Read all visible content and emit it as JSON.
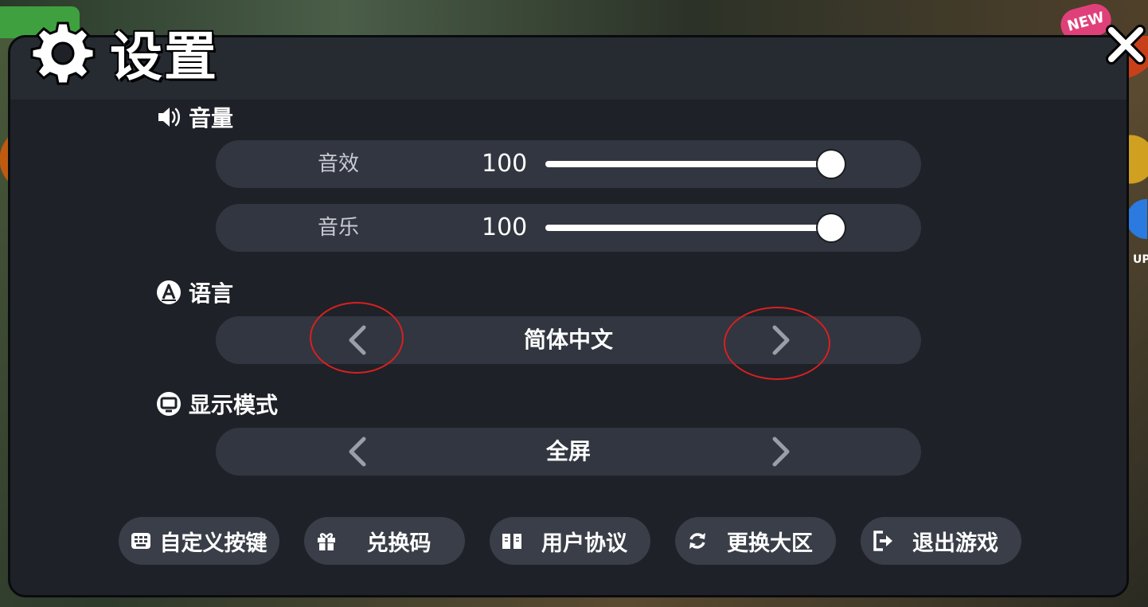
{
  "title": "设置",
  "background": {
    "badge": "NEW",
    "side_text": "UP"
  },
  "volume": {
    "section_label": "音量",
    "sliders": [
      {
        "label": "音效",
        "value": "100",
        "level": 100
      },
      {
        "label": "音乐",
        "value": "100",
        "level": 100
      }
    ]
  },
  "language": {
    "section_label": "语言",
    "value": "简体中文"
  },
  "display": {
    "section_label": "显示模式",
    "value": "全屏"
  },
  "buttons": [
    {
      "label": "自定义按键",
      "icon": "keyboard-icon"
    },
    {
      "label": "兑换码",
      "icon": "gift-icon"
    },
    {
      "label": "用户协议",
      "icon": "book-icon"
    },
    {
      "label": "更换大区",
      "icon": "refresh-icon"
    },
    {
      "label": "退出游戏",
      "icon": "exit-icon"
    }
  ],
  "colors": {
    "dialog_bg": "#1e2128",
    "row_bg": "#323640",
    "button_bg": "#3a3e48",
    "annotation": "#d82020"
  }
}
